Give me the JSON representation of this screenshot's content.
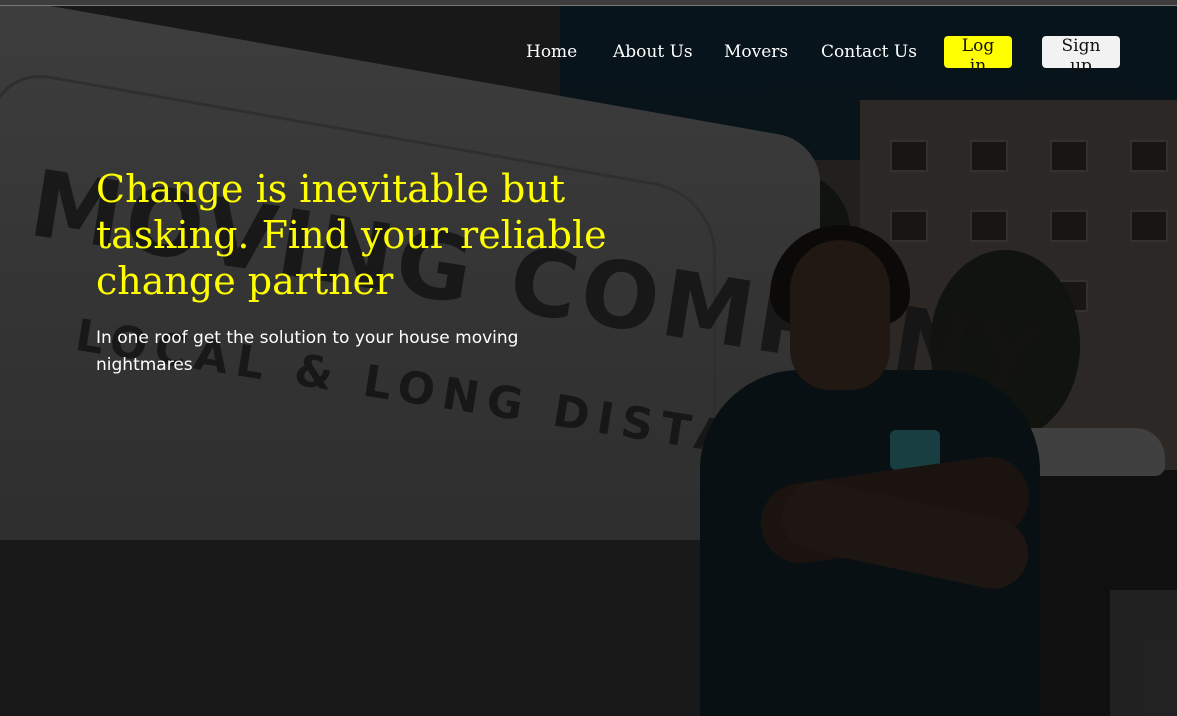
{
  "nav": {
    "links": [
      "Home",
      "About Us",
      "Movers",
      "Contact Us"
    ],
    "login_label": "Log in",
    "signup_label": "Sign up"
  },
  "hero": {
    "headline": "Change is inevitable but tasking. Find your reliable change partner",
    "subtext": "In one roof get the solution to your house moving nightmares",
    "background_image": "mover-with-van-photo",
    "van_text_line1": "MOVING COMPANY",
    "van_text_line2": "LOCAL & LONG DISTANCE"
  },
  "colors": {
    "accent": "#ffff00",
    "text_light": "#ffffff",
    "signup_bg": "#f2f2f2",
    "overlay": "rgba(0,0,0,0.42)"
  }
}
